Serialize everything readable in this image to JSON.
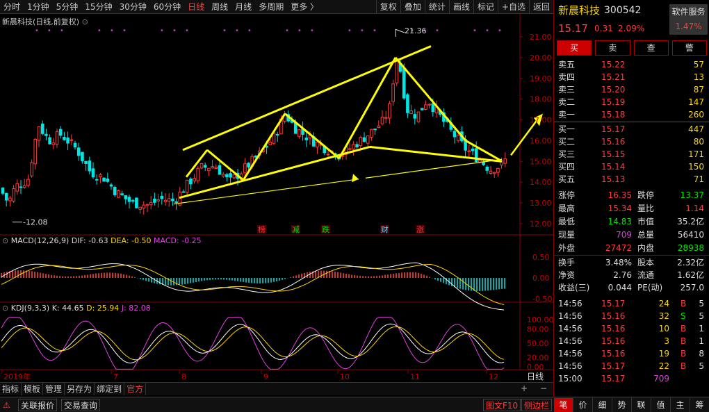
{
  "toolbar": {
    "periods": [
      "分时",
      "1分钟",
      "5分钟",
      "15分钟",
      "30分钟",
      "60分钟",
      "日线",
      "周线",
      "月线",
      "多周期",
      "更多 〉"
    ],
    "active_period": "日线",
    "right_buttons": [
      "复权",
      "叠加",
      "统计",
      "画线",
      "标记",
      "+自选",
      "返回"
    ]
  },
  "chart_title": "新晨科技(日线,前复权)",
  "price_axis": [
    "21.00",
    "20.00",
    "19.00",
    "18.00",
    "17.00",
    "16.00",
    "15.00",
    "14.00",
    "13.00",
    "12.00"
  ],
  "annotations": {
    "high": "21.36",
    "low": "12.08"
  },
  "event_markers": [
    "榜",
    "减",
    "跌",
    "财",
    "涨"
  ],
  "macd": {
    "title": "MACD(12,26,9)",
    "dif": "DIF: -0.63",
    "dea": "DEA: -0.50",
    "macd": "MACD: -0.25",
    "axis": [
      "0.50",
      "0.00",
      "-0.50"
    ]
  },
  "kdj": {
    "title": "KDJ(9,3,3)",
    "k": "K: 44.65",
    "d": "D: 25.94",
    "j": "J: 82.08",
    "axis": [
      "100.00",
      "80.00",
      "50.00",
      "20.00",
      "0.00"
    ]
  },
  "time_axis": [
    "2019年",
    "7",
    "8",
    "9",
    "10",
    "11",
    "12"
  ],
  "period_label": "日线",
  "bottom_tabs": [
    "指标",
    "模板",
    "管理",
    "另存为",
    "绑定到",
    "官方"
  ],
  "bottom_links": [
    "关联报价",
    "交易查询"
  ],
  "bottom_right": [
    "图文F10",
    "侧边栏"
  ],
  "quote": {
    "name": "新晨科技",
    "code": "300542",
    "software_service": "软件服务",
    "sector_change": "1.47%",
    "price": "15.17",
    "change": "0.31",
    "pct": "2.09%",
    "actions": [
      "买",
      "卖",
      "查",
      "警"
    ],
    "sells": [
      [
        "卖五",
        "15.22",
        "57"
      ],
      [
        "卖四",
        "15.21",
        "13"
      ],
      [
        "卖三",
        "15.20",
        "87"
      ],
      [
        "卖二",
        "15.19",
        "147"
      ],
      [
        "卖一",
        "15.18",
        "260"
      ]
    ],
    "buys": [
      [
        "买一",
        "15.17",
        "447"
      ],
      [
        "买二",
        "15.16",
        "80"
      ],
      [
        "买三",
        "15.15",
        "171"
      ],
      [
        "买四",
        "15.14",
        "150"
      ],
      [
        "买五",
        "15.13",
        "71"
      ]
    ],
    "stats1": [
      [
        "涨停",
        "16.35",
        "跌停",
        "13.37"
      ],
      [
        "最高",
        "15.34",
        "量比",
        "1.14"
      ],
      [
        "最低",
        "14.83",
        "市值",
        "35.2亿"
      ],
      [
        "现量",
        "709",
        "总量",
        "56410"
      ],
      [
        "外盘",
        "27472",
        "内盘",
        "28938"
      ]
    ],
    "stats2": [
      [
        "换手",
        "3.48%",
        "股本",
        "2.32亿"
      ],
      [
        "净资",
        "2.76",
        "流通",
        "1.62亿"
      ],
      [
        "收益(三)",
        "0.044",
        "PE(动)",
        "257.0"
      ]
    ],
    "ticks": [
      [
        "14:56",
        "15.17",
        "24",
        "B",
        "5"
      ],
      [
        "14:56",
        "15.16",
        "32",
        "S",
        "5"
      ],
      [
        "14:56",
        "15.16",
        "10",
        "B",
        "1"
      ],
      [
        "14:56",
        "15.16",
        "3",
        "B",
        "1"
      ],
      [
        "14:56",
        "15.16",
        "19",
        "B",
        "8"
      ],
      [
        "14:56",
        "15.17",
        "22",
        "B",
        "5"
      ],
      [
        "15:00",
        "15.17",
        "709",
        "",
        ""
      ]
    ],
    "tabs": [
      "笔",
      "价",
      "细",
      "势",
      "联",
      "值",
      "主",
      "筹"
    ]
  },
  "colors": {
    "up": "#ff3b3b",
    "down": "#00e5e5",
    "drawing": "#ffff00",
    "active_tab": "#d00000"
  }
}
